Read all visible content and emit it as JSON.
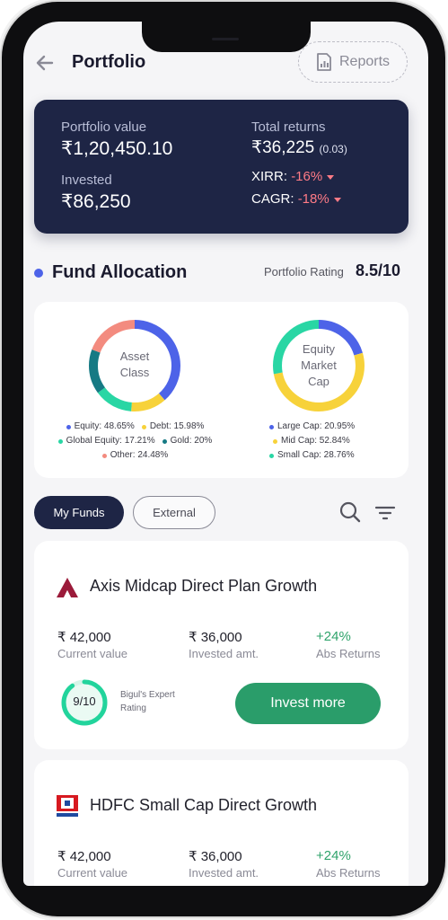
{
  "header": {
    "title": "Portfolio",
    "reports_label": "Reports"
  },
  "summary": {
    "portfolio_value_label": "Portfolio value",
    "portfolio_value": "₹1,20,450.10",
    "invested_label": "Invested",
    "invested": "₹86,250",
    "total_returns_label": "Total returns",
    "total_returns": "₹36,225",
    "total_returns_change": "(0.03)",
    "xirr_label": "XIRR:",
    "xirr_value": "-16%",
    "cagr_label": "CAGR:",
    "cagr_value": "-18%"
  },
  "fund_allocation": {
    "title": "Fund Allocation",
    "rating_label": "Portfolio Rating",
    "rating_value": "8.5/10"
  },
  "asset_class": {
    "label_line1": "Asset",
    "label_line2": "Class",
    "segments": [
      {
        "name": "Equity",
        "pct": 48.65,
        "text": "Equity: 48.65%",
        "color": "#4d63e8"
      },
      {
        "name": "Debt",
        "pct": 15.98,
        "text": "Debt: 15.98%",
        "color": "#f7d23a"
      },
      {
        "name": "Global Equity",
        "pct": 17.21,
        "text": "Global Equity: 17.21%",
        "color": "#29d6a4"
      },
      {
        "name": "Gold",
        "pct": 20,
        "text": "Gold: 20%",
        "color": "#167a84"
      },
      {
        "name": "Other",
        "pct": 24.48,
        "text": "Other: 24.48%",
        "color": "#f38b7f"
      }
    ]
  },
  "market_cap": {
    "label_line1": "Equity",
    "label_line2": "Market",
    "label_line3": "Cap",
    "segments": [
      {
        "name": "Large Cap",
        "pct": 20.95,
        "text": "Large Cap: 20.95%",
        "color": "#4d63e8"
      },
      {
        "name": "Mid Cap",
        "pct": 52.84,
        "text": "Mid Cap: 52.84%",
        "color": "#f7d23a"
      },
      {
        "name": "Small Cap",
        "pct": 28.76,
        "text": "Small Cap: 28.76%",
        "color": "#29d6a4"
      }
    ]
  },
  "tabs": {
    "my_funds": "My Funds",
    "external": "External"
  },
  "funds": [
    {
      "name": "Axis Midcap Direct Plan Growth",
      "current_value": "₹ 42,000",
      "current_label": "Current value",
      "invested": "₹ 36,000",
      "invested_label": "Invested amt.",
      "returns": "+24%",
      "returns_label": "Abs Returns",
      "rating": "9/10",
      "rating_fraction": 0.9,
      "rating_label_line1": "Bigul's Expert",
      "rating_label_line2": "Rating",
      "cta": "Invest more"
    },
    {
      "name": "HDFC Small Cap Direct Growth",
      "current_value": "₹ 42,000",
      "current_label": "Current value",
      "invested": "₹ 36,000",
      "invested_label": "Invested amt.",
      "returns": "+24%",
      "returns_label": "Abs Returns"
    }
  ],
  "colors": {
    "navy": "#1e2545",
    "accent_blue": "#4d63e8",
    "negative": "#ff7b86",
    "positive": "#2fa36b",
    "cta_green": "#2a9d6a"
  }
}
